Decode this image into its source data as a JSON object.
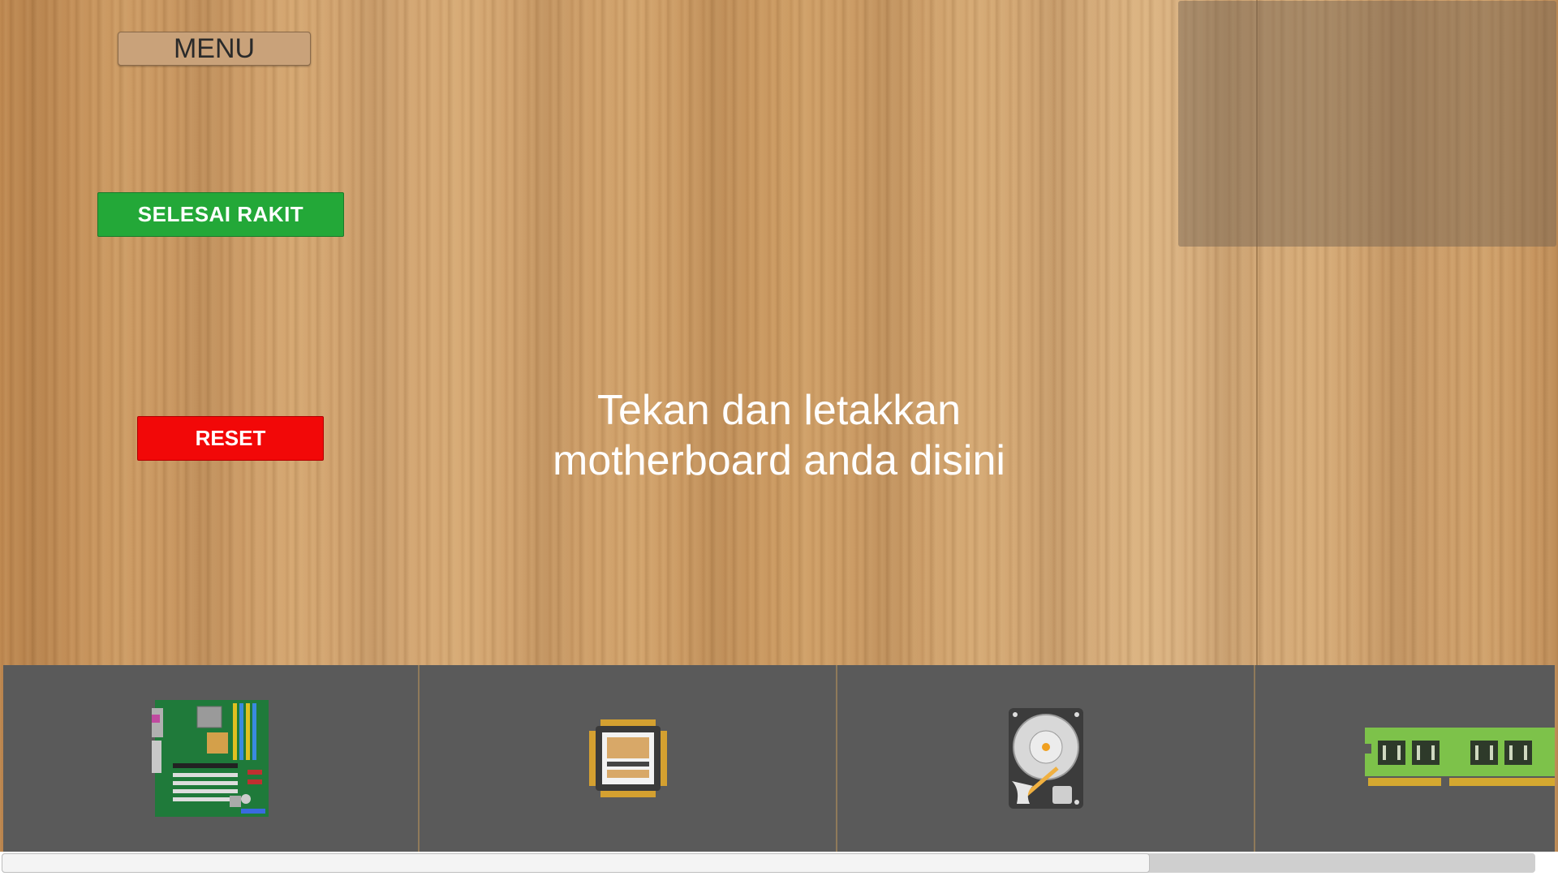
{
  "buttons": {
    "menu_label": "MENU",
    "finish_label": "SELESAI RAKIT",
    "reset_label": "RESET"
  },
  "instruction": {
    "line1": "Tekan dan letakkan",
    "line2": "motherboard anda disini"
  },
  "tray": {
    "items": [
      {
        "icon": "motherboard-icon"
      },
      {
        "icon": "cpu-icon"
      },
      {
        "icon": "hard-drive-icon"
      },
      {
        "icon": "ram-icon"
      }
    ],
    "scroll_position": 0
  },
  "colors": {
    "finish": "#23a838",
    "reset": "#f20808",
    "tray": "#5a5a5a"
  }
}
